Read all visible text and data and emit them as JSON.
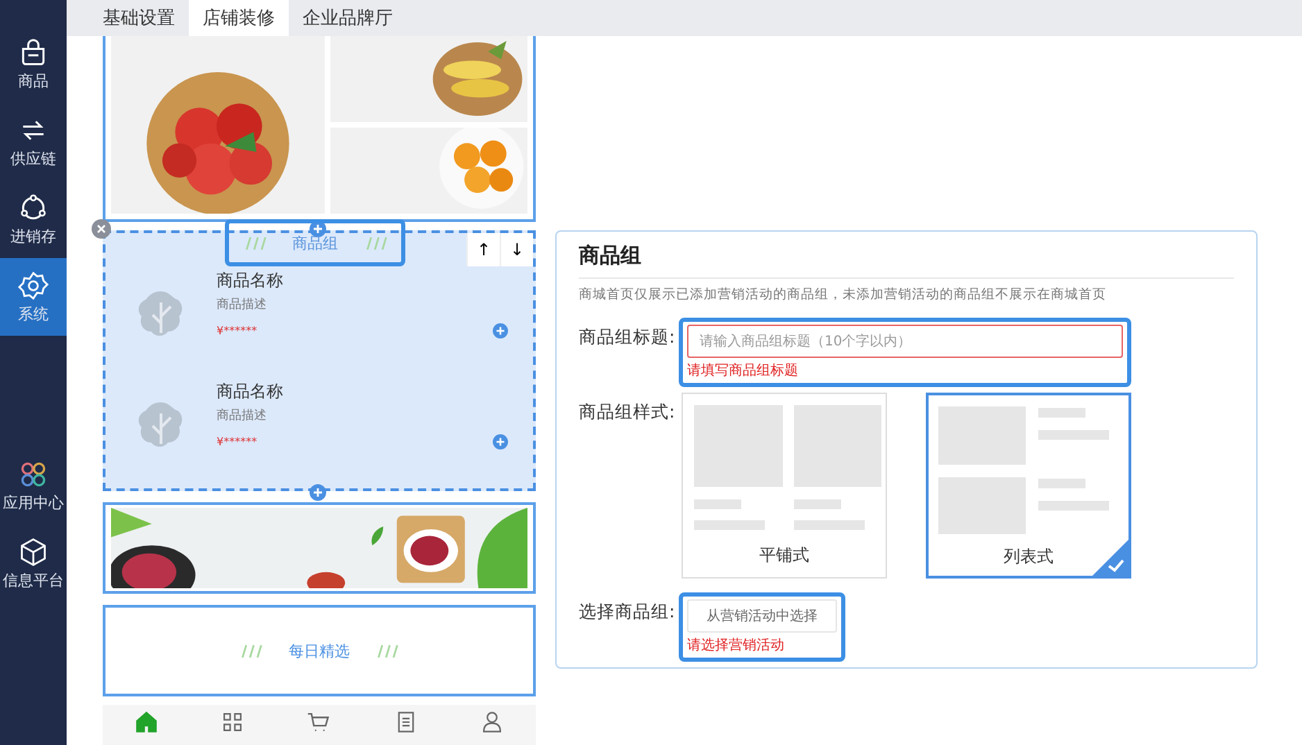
{
  "sidebar": {
    "items": [
      {
        "label": "商品",
        "selected": false
      },
      {
        "label": "供应链",
        "selected": false
      },
      {
        "label": "进销存",
        "selected": false
      },
      {
        "label": "系统",
        "selected": true
      }
    ],
    "bottom_items": [
      {
        "label": "应用中心"
      },
      {
        "label": "信息平台"
      }
    ]
  },
  "tabs": [
    {
      "label": "基础设置",
      "selected": false
    },
    {
      "label": "店铺装修",
      "selected": true
    },
    {
      "label": "企业品牌厅",
      "selected": false
    }
  ],
  "preview": {
    "goods_group": {
      "title": "商品组",
      "selected": true,
      "move_buttons": [
        "↑",
        "↓"
      ],
      "products": [
        {
          "name": "商品名称",
          "desc": "商品描述",
          "price": "¥******"
        },
        {
          "name": "商品名称",
          "desc": "商品描述",
          "price": "¥******"
        }
      ]
    },
    "title_block": {
      "title": "每日精选"
    },
    "bottom_nav": [
      {
        "selected": true
      },
      {
        "selected": false
      },
      {
        "selected": false
      },
      {
        "selected": false
      },
      {
        "selected": false
      }
    ]
  },
  "panel": {
    "title": "商品组",
    "note": "商城首页仅展示已添加营销活动的商品组，未添加营销活动的商品组不展示在商城首页",
    "title_field": {
      "label": "商品组标题:",
      "placeholder": "请输入商品组标题（10个字以内）",
      "error": "请填写商品组标题"
    },
    "style_field": {
      "label": "商品组样式:",
      "options": [
        {
          "label": "平铺式",
          "kind": "grid",
          "selected": false
        },
        {
          "label": "列表式",
          "kind": "list",
          "selected": true
        }
      ]
    },
    "select_field": {
      "label": "选择商品组:",
      "button": "从营销活动中选择",
      "error": "请选择营销活动"
    }
  }
}
